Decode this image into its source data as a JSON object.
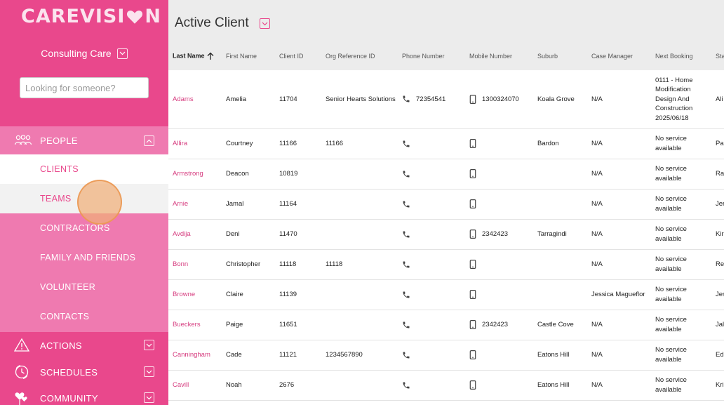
{
  "app": {
    "logo_left": "CAREVISI",
    "logo_right": "N",
    "org_name": "Consulting Care",
    "search_placeholder": "Looking for someone?"
  },
  "sidebar": {
    "people": {
      "label": "PEOPLE",
      "items": [
        "CLIENTS",
        "TEAMS",
        "CONTRACTORS",
        "FAMILY AND FRIENDS",
        "VOLUNTEER",
        "CONTACTS"
      ],
      "active_index": 0,
      "hover_index": 1
    },
    "sections": [
      {
        "label": "ACTIONS",
        "icon": "warning-icon"
      },
      {
        "label": "SCHEDULES",
        "icon": "clock-icon"
      },
      {
        "label": "COMMUNITY",
        "icon": "hearts-icon"
      }
    ]
  },
  "colors": {
    "brand_pink": "#e9488c",
    "people_block": "#ef7ab0",
    "link_pink": "#d63c7f"
  },
  "main": {
    "title": "Active Client",
    "columns": [
      "Last Name",
      "First Name",
      "Client ID",
      "Org Reference ID",
      "Phone Number",
      "Mobile Number",
      "Suburb",
      "Case Manager",
      "Next Booking",
      "Sta"
    ],
    "sorted_column": "Last Name",
    "rows": [
      {
        "last": "Adams",
        "first": "Amelia",
        "id": "11704",
        "org_ref": "Senior Hearts Solutions",
        "phone": "72354541",
        "mobile": "1300324070",
        "suburb": "Koala Grove",
        "case_manager": "N/A",
        "booking": "0111 - Home Modification Design And Construction 2025/06/18",
        "staff": "Ali"
      },
      {
        "last": "Allira",
        "first": "Courtney",
        "id": "11166",
        "org_ref": "11166",
        "phone": "",
        "mobile": "",
        "suburb": "Bardon",
        "case_manager": "N/A",
        "booking": "No service available",
        "staff": "Pa"
      },
      {
        "last": "Armstrong",
        "first": "Deacon",
        "id": "10819",
        "org_ref": "",
        "phone": "",
        "mobile": "",
        "suburb": "",
        "case_manager": "N/A",
        "booking": "No service available",
        "staff": "Ra"
      },
      {
        "last": "Arnie",
        "first": "Jamal",
        "id": "11164",
        "org_ref": "",
        "phone": "",
        "mobile": "",
        "suburb": "",
        "case_manager": "N/A",
        "booking": "No service available",
        "staff": "Jer"
      },
      {
        "last": "Avdija",
        "first": "Deni",
        "id": "11470",
        "org_ref": "",
        "phone": "",
        "mobile": "2342423",
        "suburb": "Tarragindi",
        "case_manager": "N/A",
        "booking": "No service available",
        "staff": "Kir"
      },
      {
        "last": "Bonn",
        "first": "Christopher",
        "id": "11118",
        "org_ref": "11118",
        "phone": "",
        "mobile": "",
        "suburb": "",
        "case_manager": "N/A",
        "booking": "No service available",
        "staff": "Re"
      },
      {
        "last": "Browne",
        "first": "Claire",
        "id": "11139",
        "org_ref": "",
        "phone": "",
        "mobile": "",
        "suburb": "",
        "case_manager": "Jessica Magueflor",
        "booking": "No service available",
        "staff": "Jes"
      },
      {
        "last": "Bueckers",
        "first": "Paige",
        "id": "11651",
        "org_ref": "",
        "phone": "",
        "mobile": "2342423",
        "suburb": "Castle Cove",
        "case_manager": "N/A",
        "booking": "No service available",
        "staff": "Jal"
      },
      {
        "last": "Canningham",
        "first": "Cade",
        "id": "11121",
        "org_ref": "1234567890",
        "phone": "",
        "mobile": "",
        "suburb": "Eatons Hill",
        "case_manager": "N/A",
        "booking": "No service available",
        "staff": "Ed"
      },
      {
        "last": "Cavill",
        "first": "Noah",
        "id": "2676",
        "org_ref": "",
        "phone": "",
        "mobile": "",
        "suburb": "Eatons Hill",
        "case_manager": "N/A",
        "booking": "No service available",
        "staff": "Kri"
      }
    ]
  }
}
